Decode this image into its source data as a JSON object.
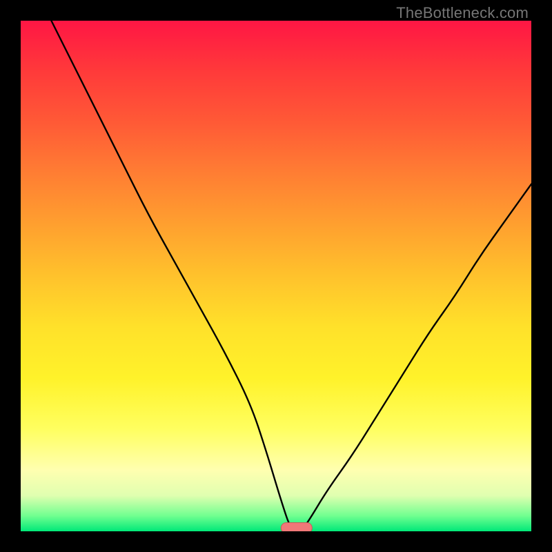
{
  "watermark": "TheBottleneck.com",
  "chart_data": {
    "type": "line",
    "title": "",
    "xlabel": "",
    "ylabel": "",
    "xlim": [
      0,
      100
    ],
    "ylim": [
      0,
      100
    ],
    "grid": false,
    "legend": false,
    "series": [
      {
        "name": "bottleneck-curve",
        "x": [
          6,
          10,
          15,
          20,
          25,
          30,
          35,
          40,
          45,
          48,
          51,
          53,
          55,
          57,
          60,
          65,
          70,
          75,
          80,
          85,
          90,
          95,
          100
        ],
        "y": [
          100,
          92,
          82,
          72,
          62,
          53,
          44,
          35,
          25,
          16,
          6,
          0,
          0,
          3,
          8,
          15,
          23,
          31,
          39,
          46,
          54,
          61,
          68
        ]
      }
    ],
    "marker": {
      "x_center": 54,
      "y": 0,
      "width_pct": 6
    },
    "background_gradient": {
      "stops": [
        {
          "pos": 0,
          "color": "#ff1644"
        },
        {
          "pos": 50,
          "color": "#ffc22c"
        },
        {
          "pos": 80,
          "color": "#ffff60"
        },
        {
          "pos": 100,
          "color": "#00e878"
        }
      ]
    }
  }
}
